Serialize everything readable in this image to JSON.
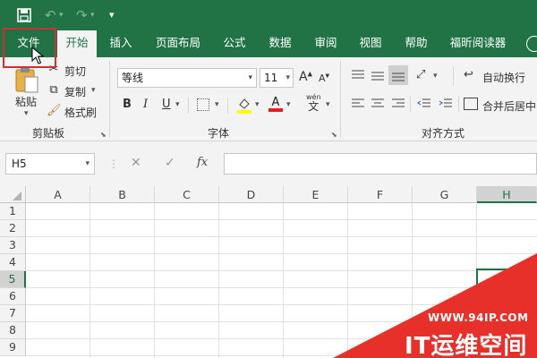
{
  "quick_access": {
    "save_icon": "save-icon",
    "undo_icon": "undo-icon",
    "redo_icon": "redo-icon",
    "customize": "▾"
  },
  "tabs": [
    {
      "label": "文件",
      "active": false
    },
    {
      "label": "开始",
      "active": true
    },
    {
      "label": "插入",
      "active": false
    },
    {
      "label": "页面布局",
      "active": false
    },
    {
      "label": "公式",
      "active": false
    },
    {
      "label": "数据",
      "active": false
    },
    {
      "label": "审阅",
      "active": false
    },
    {
      "label": "视图",
      "active": false
    },
    {
      "label": "帮助",
      "active": false
    },
    {
      "label": "福昕阅读器",
      "active": false
    }
  ],
  "clipboard": {
    "paste": "粘贴",
    "cut": "剪切",
    "copy": "复制",
    "format_painter": "格式刷",
    "group": "剪贴板"
  },
  "font": {
    "name": "等线",
    "size": "11",
    "bold": "B",
    "italic": "I",
    "underline": "U",
    "grow": "A",
    "shrink": "A",
    "color_a": "A",
    "wen": "wén",
    "wen_char": "文",
    "group": "字体"
  },
  "alignment": {
    "wrap": "自动换行",
    "merge": "合并后居中",
    "group": "对齐方式"
  },
  "formula_bar": {
    "name_box": "H5",
    "cancel": "✕",
    "enter": "✓",
    "fx": "fx",
    "value": ""
  },
  "grid": {
    "columns": [
      "A",
      "B",
      "C",
      "D",
      "E",
      "F",
      "G",
      "H"
    ],
    "rows": [
      "1",
      "2",
      "3",
      "4",
      "5",
      "6",
      "7",
      "8",
      "9"
    ],
    "selected_column": "H",
    "selected_row": "5"
  },
  "watermark": {
    "url": "WWW.94IP.COM",
    "brand": "IT运维空间"
  },
  "colors": {
    "excel_green": "#217346",
    "highlight_red": "#d0312d",
    "watermark_red": "#e8302b"
  }
}
